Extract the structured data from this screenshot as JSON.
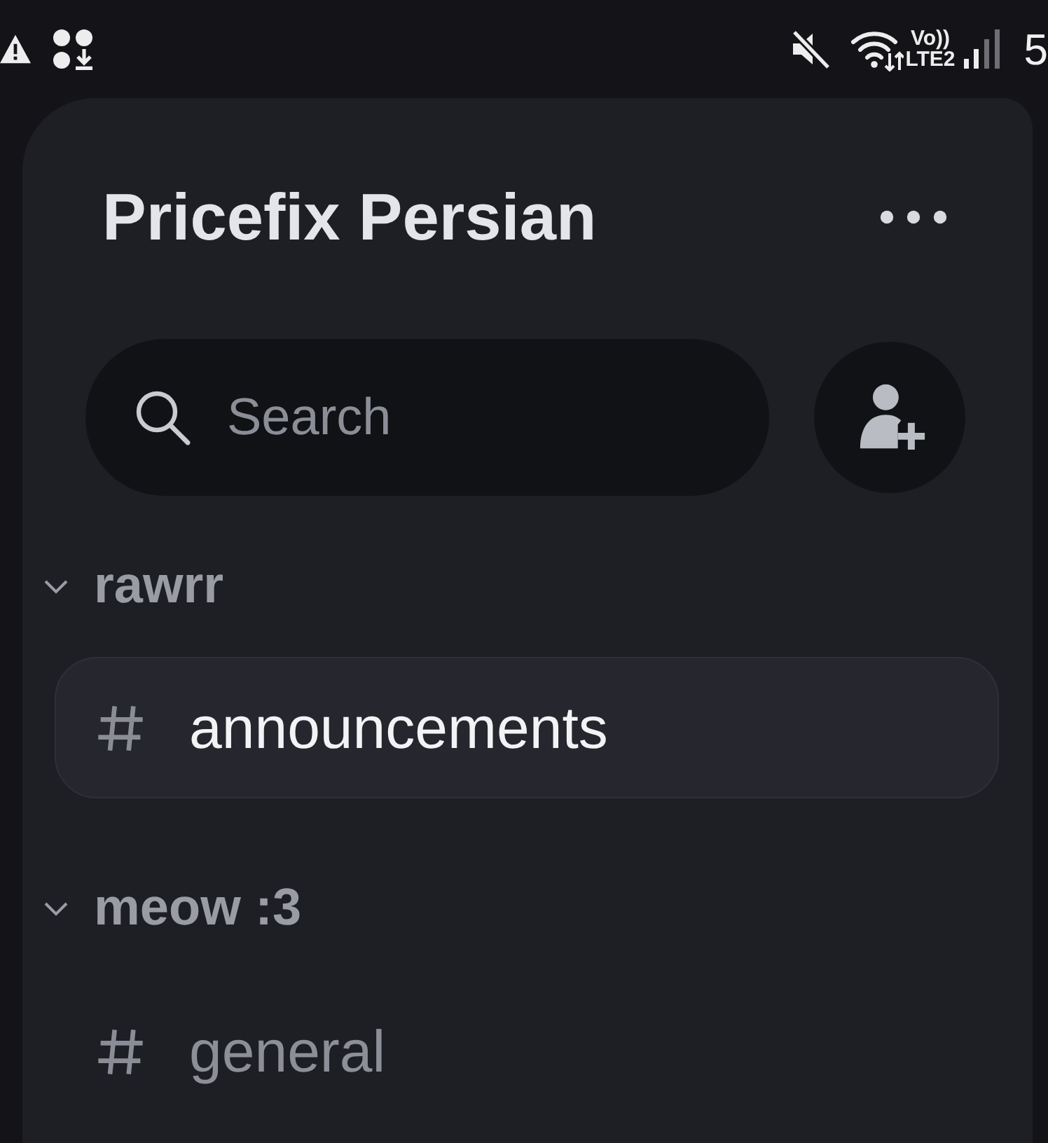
{
  "status_bar": {
    "network_lines": [
      "Vo))",
      "LTE2"
    ],
    "time": "5"
  },
  "header": {
    "title": "Pricefix Persian"
  },
  "search": {
    "placeholder": "Search"
  },
  "categories": [
    {
      "name": "rawrr",
      "expanded": true,
      "channels": [
        {
          "name": "announcements",
          "selected": true
        }
      ]
    },
    {
      "name": "meow :3",
      "expanded": true,
      "channels": [
        {
          "name": "general",
          "selected": false
        }
      ]
    }
  ]
}
